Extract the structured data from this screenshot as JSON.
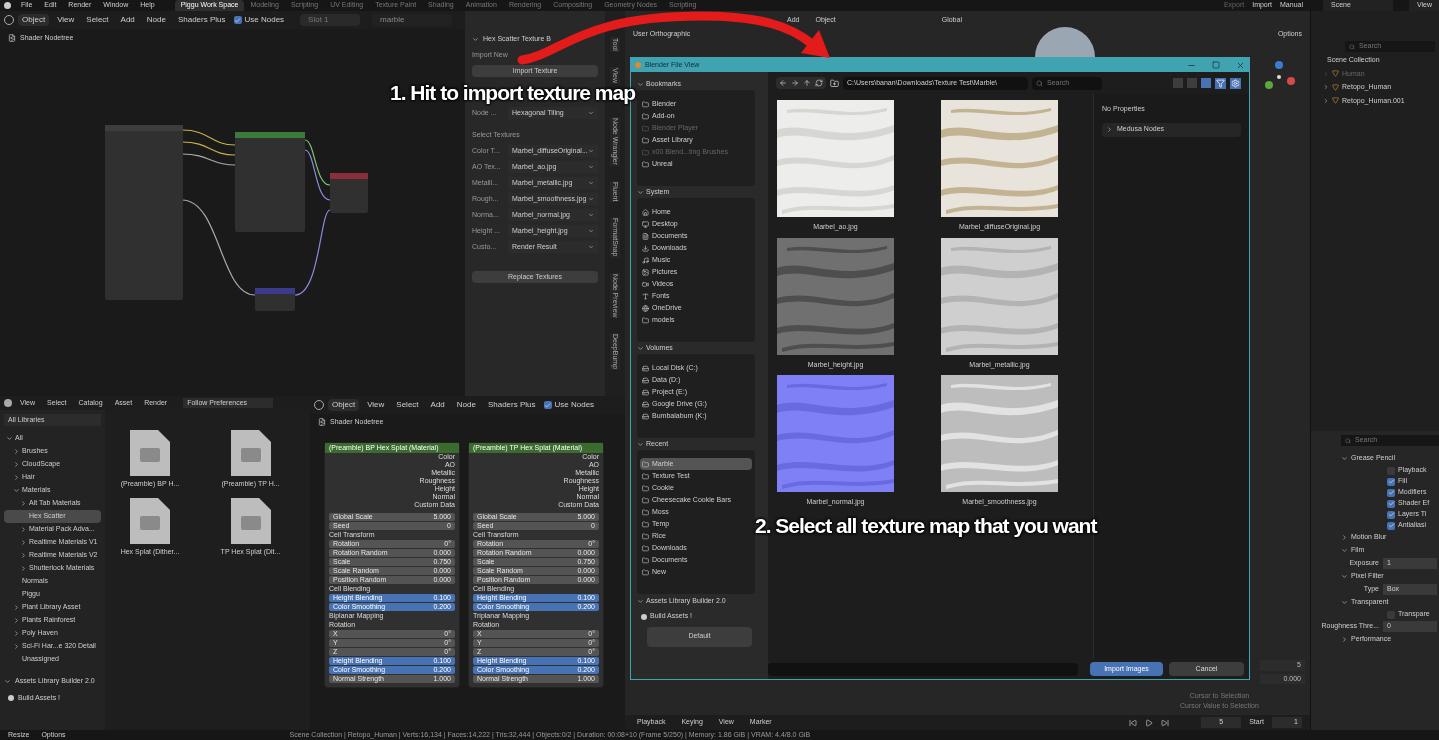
{
  "top_bar": {
    "menus": [
      "File",
      "Edit",
      "Render",
      "Window",
      "Help"
    ],
    "workspaces": [
      {
        "label": "Piggu Work Space",
        "selected": true
      },
      {
        "label": "Modeling",
        "selected": false
      },
      {
        "label": "Scripting",
        "selected": false
      },
      {
        "label": "UV Editing",
        "selected": false
      },
      {
        "label": "Texture Paint",
        "selected": false
      },
      {
        "label": "Shading",
        "selected": false
      },
      {
        "label": "Animation",
        "selected": false
      },
      {
        "label": "Rendering",
        "selected": false
      },
      {
        "label": "Compositing",
        "selected": false
      },
      {
        "label": "Geometry Nodes",
        "selected": false
      },
      {
        "label": "Scripting",
        "selected": false
      }
    ],
    "actions": [
      "Export",
      "Import",
      "Manual"
    ],
    "scene": "Scene",
    "view_layer": "View"
  },
  "node_editor": {
    "header": [
      "Object",
      "View",
      "Select",
      "Add",
      "Node",
      "Shaders Plus"
    ],
    "use_nodes": {
      "label": "Use Nodes",
      "checked": true
    },
    "slot": "Slot 1",
    "material": "marble",
    "breadcrumb": "Shader Nodetree"
  },
  "n_panel": {
    "title": "Hex Scatter Texture B",
    "import_label": "Import New",
    "import_button": "Import Texture",
    "node_field": {
      "label": "Node ...",
      "value": "Hexagonal Tiling"
    },
    "section": "Select Textures",
    "fields": [
      {
        "label": "Color T...",
        "value": "Marbel_diffuseOriginal..."
      },
      {
        "label": "AO Tex...",
        "value": "Marbel_ao.jpg"
      },
      {
        "label": "Metalli...",
        "value": "Marbel_metallic.jpg"
      },
      {
        "label": "Rough...",
        "value": "Marbel_smoothness.jpg"
      },
      {
        "label": "Norma...",
        "value": "Marbel_normal.jpg"
      },
      {
        "label": "Height ...",
        "value": "Marbel_height.jpg"
      },
      {
        "label": "Custo...",
        "value": "Render Result"
      }
    ],
    "replace_button": "Replace Textures"
  },
  "side_tabs": [
    {
      "label": "Tool",
      "selected": false
    },
    {
      "label": "View",
      "selected": false
    },
    {
      "label": "Node Wrangler",
      "selected": false
    },
    {
      "label": "Fluent",
      "selected": false
    },
    {
      "label": "FormatSnap",
      "selected": false
    },
    {
      "label": "Node Preview",
      "selected": false
    },
    {
      "label": "DeepBump",
      "selected": false
    }
  ],
  "viewport": {
    "header": [
      "Add",
      "Object"
    ],
    "orientation": "Global",
    "options": "Options",
    "view_label": "User Orthographic",
    "overlay_values": [
      "5",
      "0.000"
    ],
    "overlay_buttons": [
      "Cursor to Selection",
      "Cursor Value to Selection"
    ]
  },
  "asset_browser": {
    "header": [
      "View",
      "Select",
      "Catalog",
      "Asset",
      "Render"
    ],
    "import_method": "Follow Preferences",
    "library": "All Libraries",
    "catalogs": [
      {
        "label": "All",
        "expanded": true,
        "selected": false,
        "children": [
          {
            "label": "Brushes",
            "expanded": false,
            "selected": false
          },
          {
            "label": "CloudScape",
            "expanded": false,
            "selected": false
          },
          {
            "label": "Hair",
            "expanded": false,
            "selected": false
          },
          {
            "label": "Materials",
            "expanded": true,
            "selected": false,
            "children": [
              {
                "label": "Alt Tab Materials",
                "expanded": false,
                "selected": false
              },
              {
                "label": "Hex Scatter",
                "selected": true
              },
              {
                "label": "Material Pack Adva...",
                "expanded": false,
                "selected": false
              },
              {
                "label": "Realtime Materials V1",
                "expanded": false,
                "selected": false
              },
              {
                "label": "Realtime Materials V2",
                "expanded": false,
                "selected": false
              },
              {
                "label": "Shutterlock Materials",
                "expanded": false,
                "selected": false
              }
            ]
          },
          {
            "label": "Normals",
            "selected": false
          },
          {
            "label": "Piggu",
            "selected": false
          },
          {
            "label": "Plant Library Asset",
            "expanded": false,
            "selected": false
          },
          {
            "label": "Plants Rainforest",
            "expanded": false,
            "selected": false
          },
          {
            "label": "Poly Haven",
            "expanded": false,
            "selected": false
          },
          {
            "label": "Sci-Fi Har...e 320 Detail",
            "expanded": false,
            "selected": false
          },
          {
            "label": "Unassigned",
            "selected": false
          }
        ]
      }
    ],
    "assets": [
      "(Preamble) BP H...",
      "(Preamble) TP H...",
      "Hex Splat (Dither...",
      "TP Hex Splat (Dit..."
    ],
    "panel_title": "Assets Library Builder 2.0",
    "panel_button": "Build Assets !"
  },
  "node_editor_2": {
    "header": [
      "Object",
      "View",
      "Select",
      "Add",
      "Node",
      "Shaders Plus"
    ],
    "use_nodes": {
      "label": "Use Nodes",
      "checked": true
    },
    "breadcrumb": "Shader Nodetree",
    "nodes": [
      {
        "title": "(Preamble) BP Hex Splat (Material)",
        "outputs": [
          "Color",
          "AO",
          "Metallic",
          "Roughness",
          "Height",
          "Normal",
          "Custom Data"
        ],
        "rows": [
          {
            "kind": "field",
            "label": "Global Scale",
            "value": "5.000"
          },
          {
            "kind": "field",
            "label": "Seed",
            "value": "0"
          },
          {
            "kind": "section",
            "label": "Cell Transform"
          },
          {
            "kind": "field",
            "label": "Rotation",
            "value": "0°"
          },
          {
            "kind": "field",
            "label": "Rotation Random",
            "value": "0.000"
          },
          {
            "kind": "field",
            "label": "Scale",
            "value": "0.750"
          },
          {
            "kind": "field",
            "label": "Scale Random",
            "value": "0.000"
          },
          {
            "kind": "field",
            "label": "Position Random",
            "value": "0.000"
          },
          {
            "kind": "section",
            "label": "Cell Blending"
          },
          {
            "kind": "accent",
            "label": "Height Blending",
            "value": "0.100"
          },
          {
            "kind": "accent",
            "label": "Color Smoothing",
            "value": "0.200"
          },
          {
            "kind": "section",
            "label": "Biplanar Mapping"
          },
          {
            "kind": "section",
            "label": "Rotation"
          },
          {
            "kind": "field",
            "label": "X",
            "value": "0°"
          },
          {
            "kind": "field",
            "label": "Y",
            "value": "0°"
          },
          {
            "kind": "field",
            "label": "Z",
            "value": "0°"
          },
          {
            "kind": "accent",
            "label": "Height Blending",
            "value": "0.100"
          },
          {
            "kind": "accent",
            "label": "Color Smoothing",
            "value": "0.200"
          },
          {
            "kind": "field",
            "label": "Normal Strength",
            "value": "1.000"
          }
        ]
      },
      {
        "title": "(Preamble) TP Hex Splat (Material)",
        "outputs": [
          "Color",
          "AO",
          "Metallic",
          "Roughness",
          "Height",
          "Normal",
          "Custom Data"
        ],
        "rows": [
          {
            "kind": "field",
            "label": "Global Scale",
            "value": "5.000"
          },
          {
            "kind": "field",
            "label": "Seed",
            "value": "0"
          },
          {
            "kind": "section",
            "label": "Cell Transform"
          },
          {
            "kind": "field",
            "label": "Rotation",
            "value": "0°"
          },
          {
            "kind": "field",
            "label": "Rotation Random",
            "value": "0.000"
          },
          {
            "kind": "field",
            "label": "Scale",
            "value": "0.750"
          },
          {
            "kind": "field",
            "label": "Scale Random",
            "value": "0.000"
          },
          {
            "kind": "field",
            "label": "Position Random",
            "value": "0.000"
          },
          {
            "kind": "section",
            "label": "Cell Blending"
          },
          {
            "kind": "accent",
            "label": "Height Blending",
            "value": "0.100"
          },
          {
            "kind": "accent",
            "label": "Color Smoothing",
            "value": "0.200"
          },
          {
            "kind": "section",
            "label": "Triplanar Mapping"
          },
          {
            "kind": "section",
            "label": "Rotation"
          },
          {
            "kind": "field",
            "label": "X",
            "value": "0°"
          },
          {
            "kind": "field",
            "label": "Y",
            "value": "0°"
          },
          {
            "kind": "field",
            "label": "Z",
            "value": "0°"
          },
          {
            "kind": "accent",
            "label": "Height Blending",
            "value": "0.100"
          },
          {
            "kind": "accent",
            "label": "Color Smoothing",
            "value": "0.200"
          },
          {
            "kind": "field",
            "label": "Normal Strength",
            "value": "1.000"
          }
        ]
      }
    ]
  },
  "file_dialog": {
    "title": "Blender File View",
    "path": "C:\\Users\\banan\\Downloads\\Texture Test\\Marble\\",
    "search_placeholder": "Search",
    "sections": [
      {
        "title": "Bookmarks",
        "items": [
          {
            "label": "Blender",
            "disabled": false,
            "selected": false
          },
          {
            "label": "Add-on",
            "disabled": false,
            "selected": false
          },
          {
            "label": "Blender Player",
            "disabled": true,
            "selected": false
          },
          {
            "label": "Asset Library",
            "disabled": false,
            "selected": false
          },
          {
            "label": "x00 Blend...ting Brushes",
            "disabled": true,
            "selected": false
          },
          {
            "label": "Unreal",
            "disabled": false,
            "selected": false
          }
        ]
      },
      {
        "title": "System",
        "items": [
          {
            "label": "Home",
            "disabled": false,
            "selected": false
          },
          {
            "label": "Desktop",
            "disabled": false,
            "selected": false
          },
          {
            "label": "Documents",
            "disabled": false,
            "selected": false
          },
          {
            "label": "Downloads",
            "disabled": false,
            "selected": false
          },
          {
            "label": "Music",
            "disabled": false,
            "selected": false
          },
          {
            "label": "Pictures",
            "disabled": false,
            "selected": false
          },
          {
            "label": "Videos",
            "disabled": false,
            "selected": false
          },
          {
            "label": "Fonts",
            "disabled": false,
            "selected": false
          },
          {
            "label": "OneDrive",
            "disabled": false,
            "selected": false
          },
          {
            "label": "models",
            "disabled": false,
            "selected": false
          }
        ]
      },
      {
        "title": "Volumes",
        "items": [
          {
            "label": "Local Disk (C:)",
            "disabled": false,
            "selected": false
          },
          {
            "label": "Data (D:)",
            "disabled": false,
            "selected": false
          },
          {
            "label": "Project (E:)",
            "disabled": false,
            "selected": false
          },
          {
            "label": "Google Drive (G:)",
            "disabled": false,
            "selected": false
          },
          {
            "label": "Bumbalabum (K:)",
            "disabled": false,
            "selected": false
          }
        ]
      },
      {
        "title": "Recent",
        "items": [
          {
            "label": "Marble",
            "disabled": false,
            "selected": true
          },
          {
            "label": "Texture Test",
            "disabled": false,
            "selected": false
          },
          {
            "label": "Cookie",
            "disabled": false,
            "selected": false
          },
          {
            "label": "Cheesecake Cookie Bars",
            "disabled": false,
            "selected": false
          },
          {
            "label": "Moss",
            "disabled": false,
            "selected": false
          },
          {
            "label": "Temp",
            "disabled": false,
            "selected": false
          },
          {
            "label": "Rice",
            "disabled": false,
            "selected": false
          },
          {
            "label": "Downloads",
            "disabled": false,
            "selected": false
          },
          {
            "label": "Documents",
            "disabled": false,
            "selected": false
          },
          {
            "label": "New",
            "disabled": false,
            "selected": false
          }
        ]
      }
    ],
    "builder": {
      "title": "Assets Library Builder 2.0",
      "button": "Build Assets !",
      "preset": "Default"
    },
    "files": [
      {
        "name": "Marbel_ao.jpg",
        "kind": "picture"
      },
      {
        "name": "Marbel_diffuseOriginal.jpg",
        "kind": "picture"
      },
      {
        "name": "Marbel_height.jpg",
        "kind": "picture"
      },
      {
        "name": "Marbel_metallic.jpg",
        "kind": "picture"
      },
      {
        "name": "Marbel_normal.jpg",
        "kind": "picture"
      },
      {
        "name": "Marbel_smoothness.jpg",
        "kind": "picture"
      }
    ],
    "properties_note": "No Properties",
    "properties_panel": "Medusa Nodes",
    "import_button": "Import Images",
    "cancel_button": "Cancel"
  },
  "outliner": {
    "search_placeholder": "Search",
    "root": "Scene Collection",
    "items": [
      {
        "label": "Human",
        "disabled": true
      },
      {
        "label": "Retopo_Human",
        "disabled": false
      },
      {
        "label": "Retopo_Human.001",
        "disabled": false
      }
    ]
  },
  "properties": {
    "search_placeholder": "Search",
    "rows": [
      {
        "kind": "panel",
        "label": "Grease Pencil",
        "expanded": true
      },
      {
        "kind": "check",
        "label": "Playback",
        "checked": false
      },
      {
        "kind": "check",
        "label": "Fill",
        "checked": true
      },
      {
        "kind": "check",
        "label": "Modifiers",
        "checked": true
      },
      {
        "kind": "check",
        "label": "Shader Ef",
        "checked": true
      },
      {
        "kind": "check",
        "label": "Layers Ti",
        "checked": true
      },
      {
        "kind": "check",
        "label": "Antialiasi",
        "checked": true
      },
      {
        "kind": "panel",
        "label": "Motion Blur",
        "expanded": false
      },
      {
        "kind": "panel",
        "label": "Film",
        "expanded": true
      },
      {
        "kind": "value",
        "label": "Exposure",
        "value": "1"
      },
      {
        "kind": "panel",
        "label": "Pixel Filter",
        "expanded": true
      },
      {
        "kind": "value",
        "label": "Type",
        "value": "Box"
      },
      {
        "kind": "panel",
        "label": "Transparent",
        "expanded": true
      },
      {
        "kind": "check",
        "label": "Transpare",
        "checked": false
      },
      {
        "kind": "value",
        "label": "Roughness Thre...",
        "value": "0"
      },
      {
        "kind": "panel",
        "label": "Performance",
        "expanded": false
      }
    ]
  },
  "timeline": {
    "menus": [
      "Playback",
      "Keying",
      "View",
      "Marker"
    ],
    "frame": "5",
    "start_label": "Start",
    "start": "1"
  },
  "status_bar": {
    "items": [
      "Resize",
      "Options"
    ],
    "stats": "Scene Collection | Retopo_Human | Verts:16,134 | Faces:14,222 | Tris:32,444 | Objects:0/2 | Duration: 00:08+10 (Frame 5/250) | Memory: 1.86 GiB | VRAM: 4.4/8.0 GiB"
  },
  "annotations": [
    "1. Hit to import texture map",
    "2. Select all texture map that you want"
  ]
}
